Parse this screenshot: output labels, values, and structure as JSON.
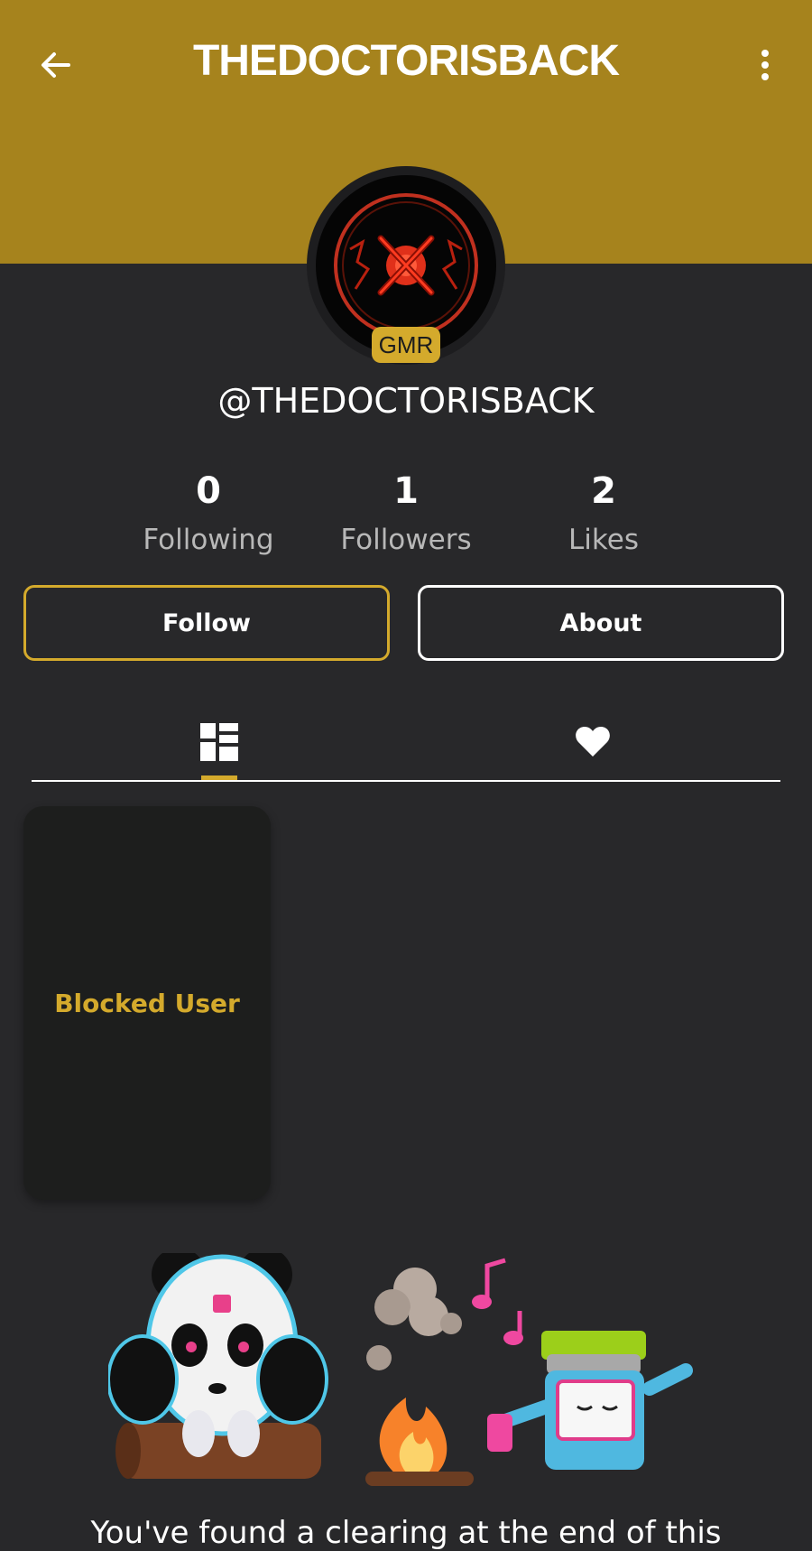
{
  "header": {
    "title": "THEDOCTORISBACK",
    "back_icon": "arrow-left-icon",
    "more_icon": "more-vertical-icon",
    "background_color": "#a6831d"
  },
  "profile": {
    "avatar_icon": "red-x-emblem",
    "badge": "GMR",
    "handle": "@THEDOCTORISBACK"
  },
  "stats": [
    {
      "value": "0",
      "label": "Following"
    },
    {
      "value": "1",
      "label": "Followers"
    },
    {
      "value": "2",
      "label": "Likes"
    }
  ],
  "actions": {
    "follow_label": "Follow",
    "about_label": "About",
    "accent_color": "#d4aa2c"
  },
  "tabs": [
    {
      "icon": "grid-icon",
      "selected": true
    },
    {
      "icon": "heart-icon",
      "selected": false
    }
  ],
  "posts": [
    {
      "label": "Blocked User"
    }
  ],
  "footer": {
    "illustration": "panda-campfire-jar-illustration",
    "message": "You've found a clearing at the end of this"
  }
}
